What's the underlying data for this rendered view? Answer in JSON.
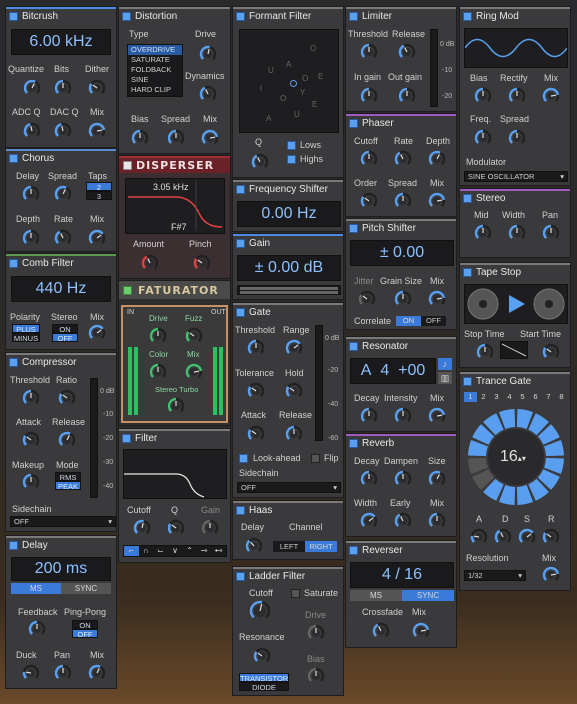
{
  "colors": {
    "accent": "#5aa0f0",
    "panel": "#3a3a3d"
  },
  "knob_icon": "knob-icon",
  "bitcrush": {
    "title": "Bitcrush",
    "value": "6.00 kHz",
    "quantize": "Quantize",
    "bits": "Bits",
    "dither": "Dither",
    "adcq": "ADC Q",
    "dacq": "DAC Q",
    "mix": "Mix"
  },
  "distortion": {
    "title": "Distortion",
    "type": "Type",
    "drive": "Drive",
    "dynamics": "Dynamics",
    "bias": "Bias",
    "spread": "Spread",
    "mix": "Mix",
    "types": [
      "OVERDRIVE",
      "SATURATE",
      "FOLDBACK",
      "SINE",
      "HARD CLIP"
    ]
  },
  "formant": {
    "title": "Formant Filter",
    "q": "Q",
    "lows": "Lows",
    "highs": "Highs",
    "letters": [
      "O",
      "A",
      "U",
      "E",
      "I",
      "Y",
      "O",
      "E",
      "U",
      "A",
      "O"
    ]
  },
  "limiter": {
    "title": "Limiter",
    "threshold": "Threshold",
    "release": "Release",
    "in_gain": "In gain",
    "out_gain": "Out gain",
    "scale": [
      "0 dB",
      "-10",
      "-20"
    ]
  },
  "ringmod": {
    "title": "Ring Mod",
    "bias": "Bias",
    "rectify": "Rectify",
    "mix": "Mix",
    "freq": "Freq.",
    "spread": "Spread",
    "modulator": "Modulator",
    "mod_value": "SINE OSCILLATOR"
  },
  "chorus": {
    "title": "Chorus",
    "delay": "Delay",
    "spread": "Spread",
    "taps": "Taps",
    "taps_a": "2",
    "taps_b": "3",
    "depth": "Depth",
    "rate": "Rate",
    "mix": "Mix"
  },
  "disperser": {
    "title": "DISPERSER",
    "freq": "3.05 kHz",
    "note": "F#7",
    "amount": "Amount",
    "pinch": "Pinch"
  },
  "freqshift": {
    "title": "Frequency Shifter",
    "value": "0.00 Hz"
  },
  "phaser": {
    "title": "Phaser",
    "cutoff": "Cutoff",
    "rate": "Rate",
    "depth": "Depth",
    "order": "Order",
    "spread": "Spread",
    "mix": "Mix"
  },
  "stereo": {
    "title": "Stereo",
    "mid": "Mid",
    "width": "Width",
    "pan": "Pan"
  },
  "comb": {
    "title": "Comb Filter",
    "value": "440 Hz",
    "polarity": "Polarity",
    "plus": "PLUS",
    "minus": "MINUS",
    "stereo": "Stereo",
    "on": "ON",
    "off": "OFF",
    "mix": "Mix"
  },
  "faturator": {
    "title": "FATURATOR",
    "in": "IN",
    "out": "OUT",
    "drive": "Drive",
    "fuzz": "Fuzz",
    "color": "Color",
    "mix": "Mix",
    "turbo": "Stereo Turbo"
  },
  "gain": {
    "title": "Gain",
    "value": "± 0.00 dB"
  },
  "pitchshift": {
    "title": "Pitch Shifter",
    "value": "± 0.00",
    "jitter": "Jitter",
    "grain": "Grain Size",
    "mix": "Mix",
    "correlate": "Correlate",
    "on": "ON",
    "off": "OFF"
  },
  "tapestop": {
    "title": "Tape Stop",
    "stop": "Stop Time",
    "start": "Start Time"
  },
  "compressor": {
    "title": "Compressor",
    "threshold": "Threshold",
    "ratio": "Ratio",
    "attack": "Attack",
    "release": "Release",
    "makeup": "Makeup",
    "mode": "Mode",
    "rms": "RMS",
    "peak": "PEAK",
    "sidechain": "Sidechain",
    "sc_value": "OFF",
    "scale": [
      "0 dB",
      "-10",
      "-20",
      "-30",
      "-40"
    ]
  },
  "gate": {
    "title": "Gate",
    "threshold": "Threshold",
    "range": "Range",
    "tolerance": "Tolerance",
    "hold": "Hold",
    "attack": "Attack",
    "release": "Release",
    "lookahead": "Look-ahead",
    "flip": "Flip",
    "sidechain": "Sidechain",
    "sc_value": "OFF",
    "scale": [
      "0 dB",
      "-20",
      "-40",
      "-60"
    ]
  },
  "resonator": {
    "title": "Resonator",
    "note": "A",
    "octave": "4",
    "cents": "+00",
    "decay": "Decay",
    "intensity": "Intensity",
    "mix": "Mix"
  },
  "trancegate": {
    "title": "Trance Gate",
    "steps": [
      "1",
      "2",
      "3",
      "4",
      "5",
      "6",
      "7",
      "8"
    ],
    "count": "16",
    "a": "A",
    "d": "D",
    "s": "S",
    "r": "R",
    "resolution": "Resolution",
    "res_value": "1/32",
    "mix": "Mix"
  },
  "filter": {
    "title": "Filter",
    "cutoff": "Cutoff",
    "q": "Q",
    "gain": "Gain"
  },
  "reverb": {
    "title": "Reverb",
    "decay": "Decay",
    "dampen": "Dampen",
    "size": "Size",
    "width": "Width",
    "early": "Early",
    "mix": "Mix"
  },
  "delay": {
    "title": "Delay",
    "value": "200 ms",
    "ms": "MS",
    "sync": "SYNC",
    "feedback": "Feedback",
    "pingpong": "Ping-Pong",
    "on": "ON",
    "off": "OFF",
    "duck": "Duck",
    "pan": "Pan",
    "mix": "Mix"
  },
  "haas": {
    "title": "Haas",
    "delay": "Delay",
    "channel": "Channel",
    "left": "LEFT",
    "right": "RIGHT"
  },
  "reverser": {
    "title": "Reverser",
    "value": "4 / 16",
    "ms": "MS",
    "sync": "SYNC",
    "crossfade": "Crossfade",
    "mix": "Mix"
  },
  "ladder": {
    "title": "Ladder Filter",
    "cutoff": "Cutoff",
    "saturate": "Saturate",
    "drive": "Drive",
    "resonance": "Resonance",
    "bias": "Bias",
    "transistor": "TRANSISTOR",
    "diode": "DIODE"
  }
}
